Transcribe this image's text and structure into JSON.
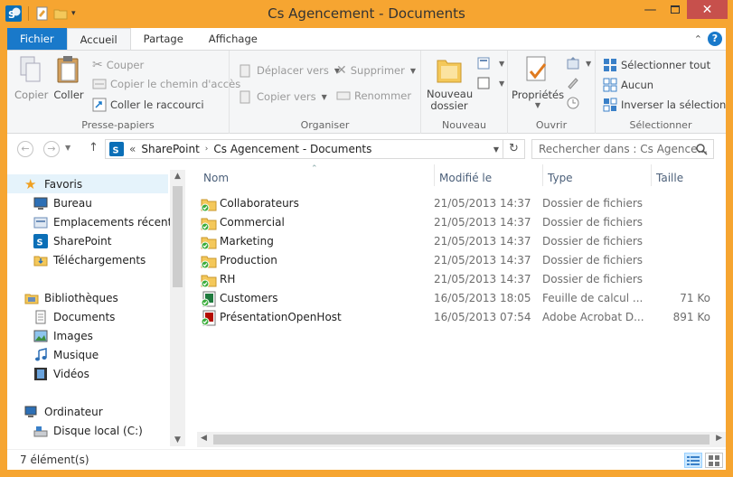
{
  "window": {
    "title": "Cs Agencement - Documents"
  },
  "tabs": {
    "file": "Fichier",
    "home": "Accueil",
    "share": "Partage",
    "view": "Affichage"
  },
  "ribbon": {
    "clipboard": {
      "label": "Presse-papiers",
      "copy": "Copier",
      "paste": "Coller",
      "cut": "Couper",
      "copy_path": "Copier le chemin d'accès",
      "paste_shortcut": "Coller le raccourci"
    },
    "organize": {
      "label": "Organiser",
      "move_to": "Déplacer vers",
      "copy_to": "Copier vers",
      "delete": "Supprimer",
      "rename": "Renommer"
    },
    "new": {
      "label": "Nouveau",
      "new_folder": "Nouveau dossier"
    },
    "open": {
      "label": "Ouvrir",
      "properties": "Propriétés"
    },
    "select": {
      "label": "Sélectionner",
      "select_all": "Sélectionner tout",
      "select_none": "Aucun",
      "invert": "Inverser la sélection"
    }
  },
  "address": {
    "chevrons": "«",
    "crumbs": [
      "SharePoint",
      "Cs Agencement - Documents"
    ],
    "search_placeholder": "Rechercher dans : Cs Agence..."
  },
  "nav": {
    "favorites": "Favoris",
    "desktop": "Bureau",
    "recent": "Emplacements récents",
    "sharepoint": "SharePoint",
    "downloads": "Téléchargements",
    "libraries": "Bibliothèques",
    "documents": "Documents",
    "images": "Images",
    "music": "Musique",
    "videos": "Vidéos",
    "computer": "Ordinateur",
    "local_disk": "Disque local (C:)"
  },
  "columns": {
    "name": "Nom",
    "modified": "Modifié le",
    "type": "Type",
    "size": "Taille"
  },
  "files": [
    {
      "name": "Collaborateurs",
      "modified": "21/05/2013 14:37",
      "type": "Dossier de fichiers",
      "size": "",
      "kind": "folder"
    },
    {
      "name": "Commercial",
      "modified": "21/05/2013 14:37",
      "type": "Dossier de fichiers",
      "size": "",
      "kind": "folder"
    },
    {
      "name": "Marketing",
      "modified": "21/05/2013 14:37",
      "type": "Dossier de fichiers",
      "size": "",
      "kind": "folder"
    },
    {
      "name": "Production",
      "modified": "21/05/2013 14:37",
      "type": "Dossier de fichiers",
      "size": "",
      "kind": "folder"
    },
    {
      "name": "RH",
      "modified": "21/05/2013 14:37",
      "type": "Dossier de fichiers",
      "size": "",
      "kind": "folder"
    },
    {
      "name": "Customers",
      "modified": "16/05/2013 18:05",
      "type": "Feuille de calcul ...",
      "size": "71 Ko",
      "kind": "excel"
    },
    {
      "name": "PrésentationOpenHost",
      "modified": "16/05/2013 07:54",
      "type": "Adobe Acrobat D...",
      "size": "891 Ko",
      "kind": "pdf"
    }
  ],
  "status": {
    "count": "7 élément(s)"
  },
  "colors": {
    "frame": "#f6a531",
    "file_tab": "#1979ca",
    "selected": "#e5f3fb"
  }
}
